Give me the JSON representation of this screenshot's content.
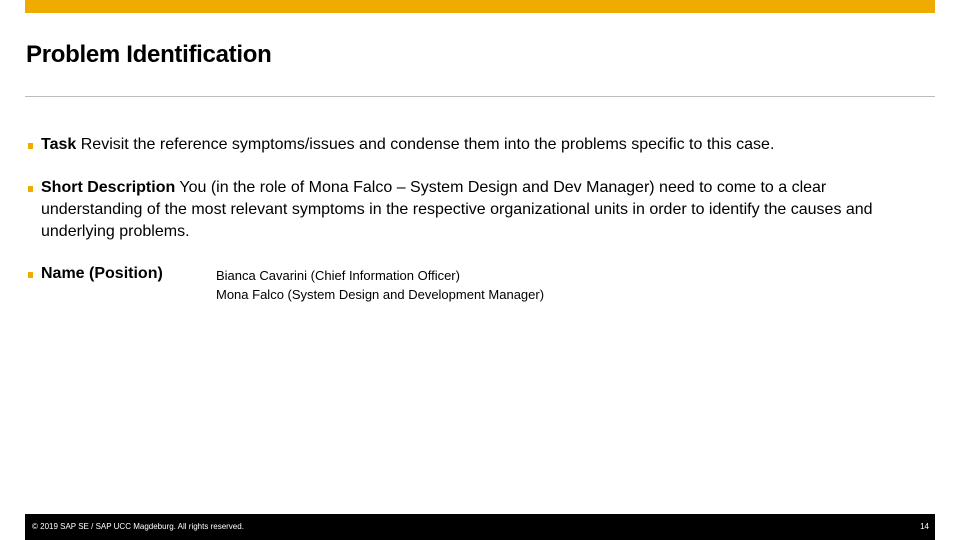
{
  "colors": {
    "accent": "#f0ab00",
    "footer_background": "#000000",
    "rule": "#bcbcbc"
  },
  "slide": {
    "title": "Problem Identification",
    "bullets": {
      "task": {
        "label": "Task",
        "text": "Revisit the reference symptoms/issues and condense them into the problems specific to this case."
      },
      "short_description": {
        "label": "Short Description",
        "text": "You (in the role of Mona Falco – System Design and Dev Manager) need to come to a clear understanding of the most relevant symptoms in the respective organizational units in order to identify the causes and underlying problems."
      },
      "name_position": {
        "label": "Name (Position)",
        "names": [
          "Bianca Cavarini (Chief Information Officer)",
          "Mona Falco (System Design and Development Manager)"
        ]
      }
    }
  },
  "footer": {
    "copyright": "© 2019 SAP SE / SAP UCC Magdeburg. All rights reserved.",
    "page_number": "14"
  }
}
